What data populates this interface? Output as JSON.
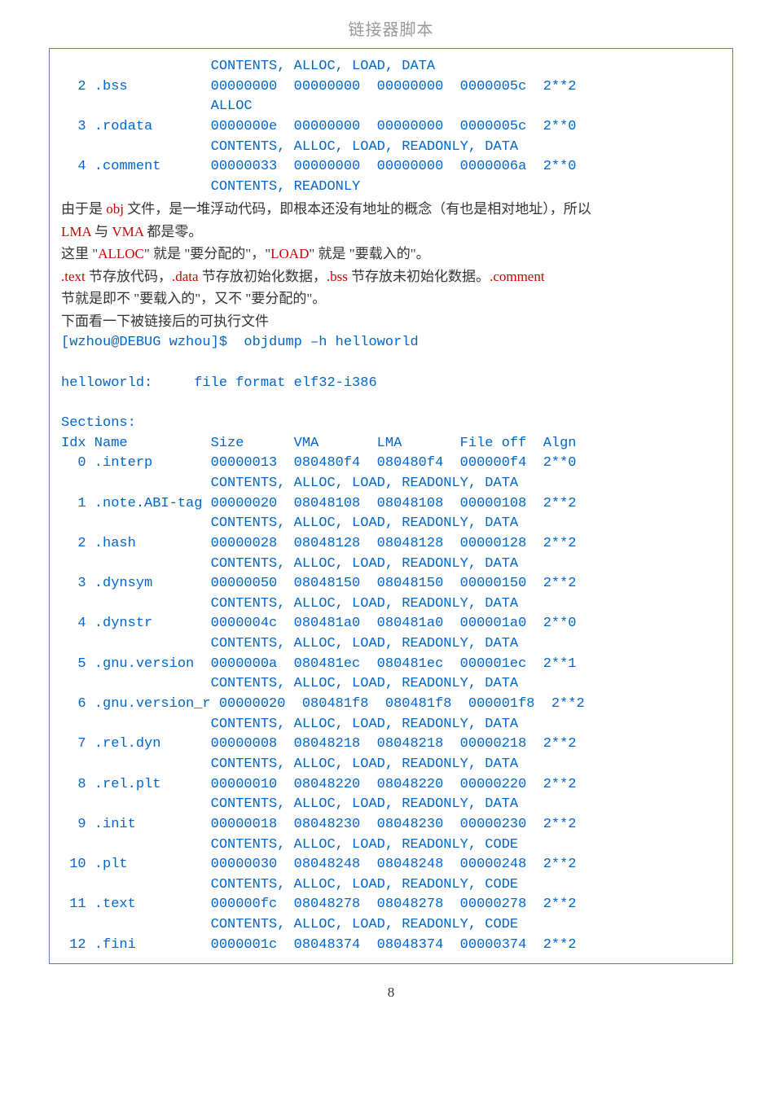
{
  "header": "链接器脚本",
  "lines": [
    {
      "type": "code",
      "text": "                  CONTENTS, ALLOC, LOAD, DATA"
    },
    {
      "type": "code",
      "text": "  2 .bss          00000000  00000000  00000000  0000005c  2**2"
    },
    {
      "type": "code",
      "text": "                  ALLOC"
    },
    {
      "type": "code",
      "text": "  3 .rodata       0000000e  00000000  00000000  0000005c  2**0"
    },
    {
      "type": "code",
      "text": "                  CONTENTS, ALLOC, LOAD, READONLY, DATA"
    },
    {
      "type": "code",
      "text": "  4 .comment      00000033  00000000  00000000  0000006a  2**0"
    },
    {
      "type": "code",
      "text": "                  CONTENTS, READONLY"
    },
    {
      "type": "prose",
      "spans": [
        {
          "t": "由于是 ",
          "c": ""
        },
        {
          "t": "obj",
          "c": "red"
        },
        {
          "t": " 文件，是一堆浮动代码，即根本还没有地址的概念（有也是相对地址），所以",
          "c": ""
        }
      ]
    },
    {
      "type": "prose",
      "spans": [
        {
          "t": "LMA",
          "c": "red"
        },
        {
          "t": " 与 ",
          "c": ""
        },
        {
          "t": "VMA",
          "c": "red"
        },
        {
          "t": " 都是零。",
          "c": ""
        }
      ]
    },
    {
      "type": "prose",
      "spans": [
        {
          "t": "这里 \"",
          "c": ""
        },
        {
          "t": "ALLOC",
          "c": "red"
        },
        {
          "t": "\" 就是 \"要分配的\"，\"",
          "c": ""
        },
        {
          "t": "LOAD",
          "c": "red"
        },
        {
          "t": "\"  就是 \"要载入的\"。",
          "c": ""
        }
      ]
    },
    {
      "type": "prose",
      "spans": [
        {
          "t": ".text",
          "c": "red"
        },
        {
          "t": " 节存放代码，",
          "c": ""
        },
        {
          "t": ".data",
          "c": "red"
        },
        {
          "t": " 节存放初始化数据，",
          "c": ""
        },
        {
          "t": ".bss",
          "c": "red"
        },
        {
          "t": " 节存放未初始化数据。",
          "c": ""
        },
        {
          "t": ".comment",
          "c": "red"
        }
      ]
    },
    {
      "type": "prose",
      "spans": [
        {
          "t": "节就是即不 \"要载入的\"，又不 \"要分配的\"。",
          "c": ""
        }
      ]
    },
    {
      "type": "prose",
      "spans": [
        {
          "t": "下面看一下被链接后的可执行文件",
          "c": ""
        }
      ]
    },
    {
      "type": "code",
      "text": "[wzhou@DEBUG wzhou]$  objdump –h helloworld"
    },
    {
      "type": "code",
      "text": " "
    },
    {
      "type": "code",
      "text": "helloworld:     file format elf32-i386"
    },
    {
      "type": "code",
      "text": " "
    },
    {
      "type": "code",
      "text": "Sections:"
    },
    {
      "type": "code",
      "text": "Idx Name          Size      VMA       LMA       File off  Algn"
    },
    {
      "type": "code",
      "text": "  0 .interp       00000013  080480f4  080480f4  000000f4  2**0"
    },
    {
      "type": "code",
      "text": "                  CONTENTS, ALLOC, LOAD, READONLY, DATA"
    },
    {
      "type": "code",
      "text": "  1 .note.ABI-tag 00000020  08048108  08048108  00000108  2**2"
    },
    {
      "type": "code",
      "text": "                  CONTENTS, ALLOC, LOAD, READONLY, DATA"
    },
    {
      "type": "code",
      "text": "  2 .hash         00000028  08048128  08048128  00000128  2**2"
    },
    {
      "type": "code",
      "text": "                  CONTENTS, ALLOC, LOAD, READONLY, DATA"
    },
    {
      "type": "code",
      "text": "  3 .dynsym       00000050  08048150  08048150  00000150  2**2"
    },
    {
      "type": "code",
      "text": "                  CONTENTS, ALLOC, LOAD, READONLY, DATA"
    },
    {
      "type": "code",
      "text": "  4 .dynstr       0000004c  080481a0  080481a0  000001a0  2**0"
    },
    {
      "type": "code",
      "text": "                  CONTENTS, ALLOC, LOAD, READONLY, DATA"
    },
    {
      "type": "code",
      "text": "  5 .gnu.version  0000000a  080481ec  080481ec  000001ec  2**1"
    },
    {
      "type": "code",
      "text": "                  CONTENTS, ALLOC, LOAD, READONLY, DATA"
    },
    {
      "type": "code",
      "text": "  6 .gnu.version_r 00000020  080481f8  080481f8  000001f8  2**2"
    },
    {
      "type": "code",
      "text": "                  CONTENTS, ALLOC, LOAD, READONLY, DATA"
    },
    {
      "type": "code",
      "text": "  7 .rel.dyn      00000008  08048218  08048218  00000218  2**2"
    },
    {
      "type": "code",
      "text": "                  CONTENTS, ALLOC, LOAD, READONLY, DATA"
    },
    {
      "type": "code",
      "text": "  8 .rel.plt      00000010  08048220  08048220  00000220  2**2"
    },
    {
      "type": "code",
      "text": "                  CONTENTS, ALLOC, LOAD, READONLY, DATA"
    },
    {
      "type": "code",
      "text": "  9 .init         00000018  08048230  08048230  00000230  2**2"
    },
    {
      "type": "code",
      "text": "                  CONTENTS, ALLOC, LOAD, READONLY, CODE"
    },
    {
      "type": "code",
      "text": " 10 .plt          00000030  08048248  08048248  00000248  2**2"
    },
    {
      "type": "code",
      "text": "                  CONTENTS, ALLOC, LOAD, READONLY, CODE"
    },
    {
      "type": "code",
      "text": " 11 .text         000000fc  08048278  08048278  00000278  2**2"
    },
    {
      "type": "code",
      "text": "                  CONTENTS, ALLOC, LOAD, READONLY, CODE"
    },
    {
      "type": "code",
      "text": " 12 .fini         0000001c  08048374  08048374  00000374  2**2"
    }
  ],
  "page_number": "8"
}
